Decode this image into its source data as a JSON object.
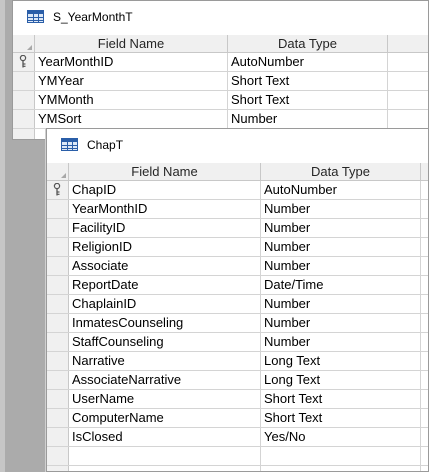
{
  "tables": [
    {
      "title": "S_YearMonthT",
      "headers": {
        "field_name": "Field Name",
        "data_type": "Data Type"
      },
      "rows": [
        {
          "field": "YearMonthID",
          "type": "AutoNumber",
          "key": true
        },
        {
          "field": "YMYear",
          "type": "Short Text",
          "key": false
        },
        {
          "field": "YMMonth",
          "type": "Short Text",
          "key": false
        },
        {
          "field": "YMSort",
          "type": "Number",
          "key": false
        }
      ]
    },
    {
      "title": "ChapT",
      "headers": {
        "field_name": "Field Name",
        "data_type": "Data Type"
      },
      "rows": [
        {
          "field": "ChapID",
          "type": "AutoNumber",
          "key": true
        },
        {
          "field": "YearMonthID",
          "type": "Number",
          "key": false
        },
        {
          "field": "FacilityID",
          "type": "Number",
          "key": false
        },
        {
          "field": "ReligionID",
          "type": "Number",
          "key": false
        },
        {
          "field": "Associate",
          "type": "Number",
          "key": false
        },
        {
          "field": "ReportDate",
          "type": "Date/Time",
          "key": false
        },
        {
          "field": "ChaplainID",
          "type": "Number",
          "key": false
        },
        {
          "field": "InmatesCounseling",
          "type": "Number",
          "key": false
        },
        {
          "field": "StaffCounseling",
          "type": "Number",
          "key": false
        },
        {
          "field": "Narrative",
          "type": "Long Text",
          "key": false
        },
        {
          "field": "AssociateNarrative",
          "type": "Long Text",
          "key": false
        },
        {
          "field": "UserName",
          "type": "Short Text",
          "key": false
        },
        {
          "field": "ComputerName",
          "type": "Short Text",
          "key": false
        },
        {
          "field": "IsClosed",
          "type": "Yes/No",
          "key": false
        }
      ]
    }
  ],
  "icons": {
    "table": "table-icon",
    "primary_key": "key-icon"
  }
}
